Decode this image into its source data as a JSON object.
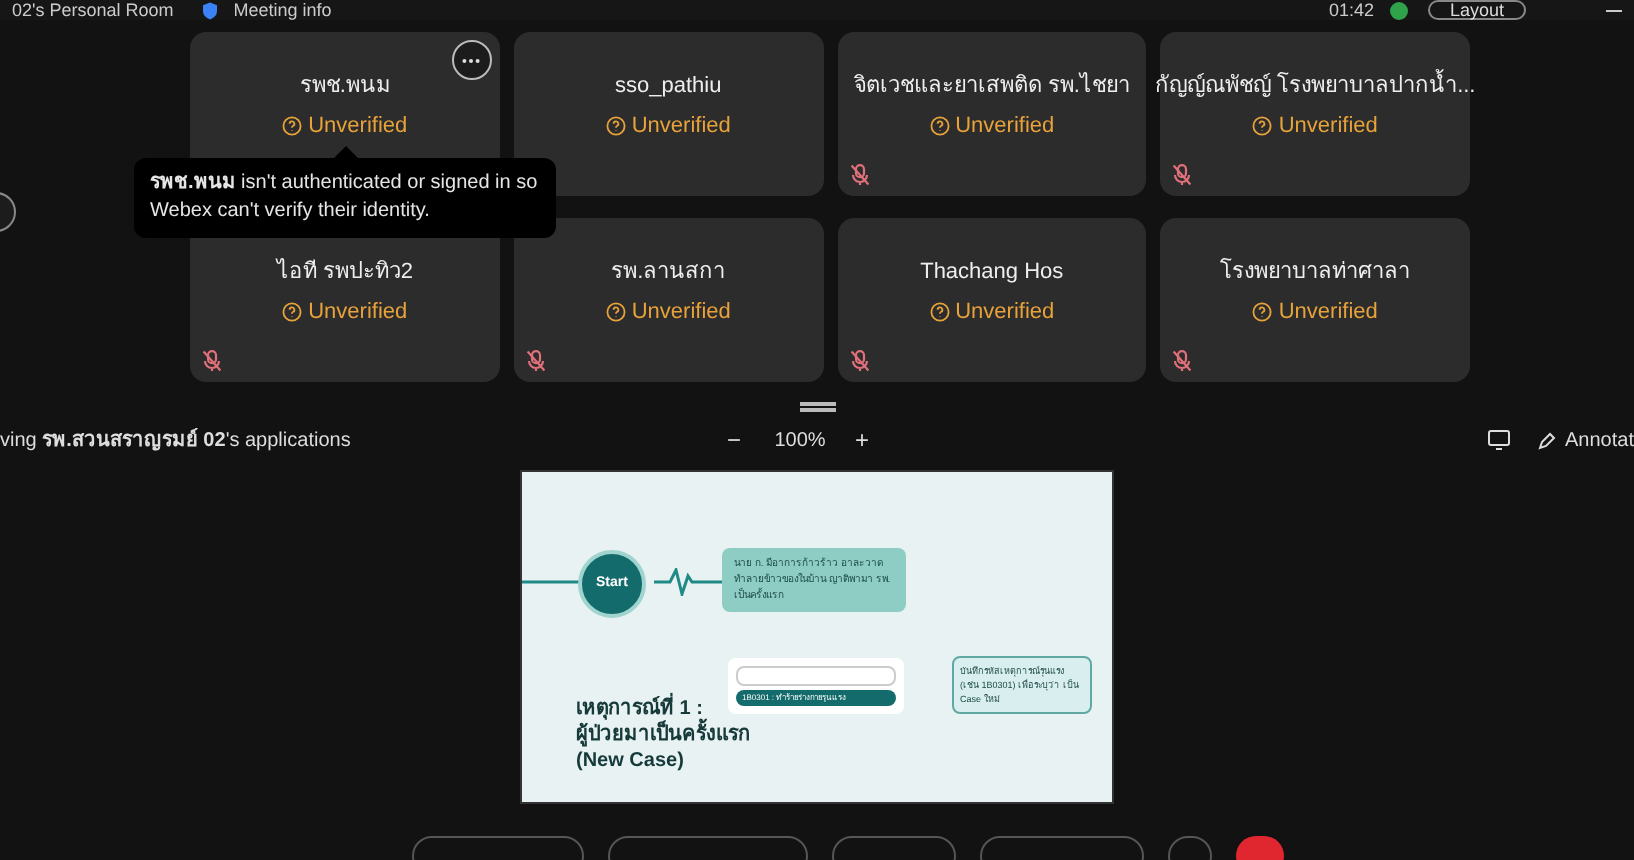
{
  "top_bar": {
    "room": "02's Personal Room",
    "meeting_info": "Meeting info",
    "time": "01:42",
    "layout_button": "Layout"
  },
  "participants": [
    {
      "name": "รพช.พนม",
      "status": "Unverified",
      "menu": true
    },
    {
      "name": "sso_pathiu",
      "status": "Unverified",
      "menu": false
    },
    {
      "name": "จิตเวชและยาเสพติด รพ.ไชยา",
      "status": "Unverified",
      "muted": true,
      "menu": false
    },
    {
      "name": "กัญญ์ณพัชญ์ โรงพยาบาลปากน้ำ...",
      "status": "Unverified",
      "muted": true,
      "menu": false
    },
    {
      "name": "ไอที รพปะทิว2",
      "status": "Unverified",
      "muted": true,
      "menu": false
    },
    {
      "name": "รพ.ลานสกา",
      "status": "Unverified",
      "muted": true,
      "menu": false
    },
    {
      "name": "Thachang Hos",
      "status": "Unverified",
      "muted": true,
      "menu": false
    },
    {
      "name": "โรงพยาบาลท่าศาลา",
      "status": "Unverified",
      "muted": true,
      "menu": false
    }
  ],
  "tooltip": "**รพช.พนม** isn't authenticated or signed in so Webex can't verify their identity.",
  "share_bar": {
    "title": "ving **รพ.สวนสราญรมย์ 02**'s applications",
    "zoom_out": "−",
    "zoom": "100%",
    "zoom_in": "+",
    "annotate": "Annotat"
  },
  "slide": {
    "start": "Start",
    "event_box": "นาย ก. มีอาการก้าวร้าว อาละวาดทำลายข้าวของในบ้าน ญาติพามา รพ. เป็นครั้งแรก",
    "code_option": "1B0301 : ทำร้ายร่างกายรุนแรง",
    "note_box": "บันทึกรหัสเหตุการณ์รุนแรง (เช่น 1B0301) เพื่อระบุว่า เป็น Case ใหม่",
    "heading_1": "เหตุการณ์ที่ 1 :",
    "heading_2": "ผู้ป่วยมาเป็นครั้งแรก",
    "heading_3": "(New Case)"
  }
}
